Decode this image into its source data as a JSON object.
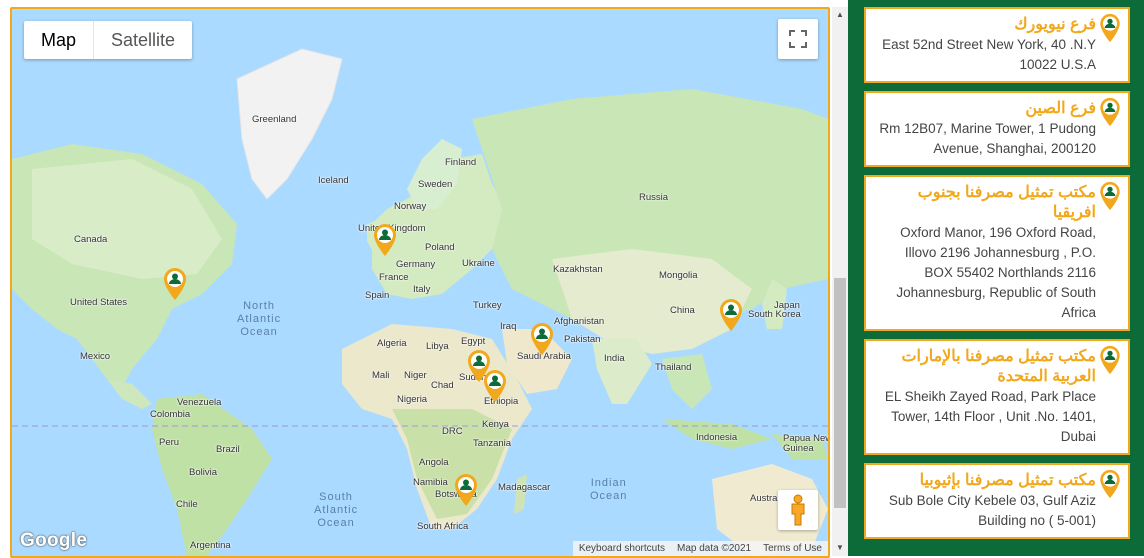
{
  "map": {
    "type_control": {
      "map_label": "Map",
      "satellite_label": "Satellite"
    },
    "logo": "Google",
    "attribution": {
      "shortcuts": "Keyboard shortcuts",
      "data": "Map data ©2021",
      "terms": "Terms of Use"
    },
    "labels": {
      "greenland": "Greenland",
      "iceland": "Iceland",
      "finland": "Finland",
      "sweden": "Sweden",
      "norway": "Norway",
      "russia": "Russia",
      "uk": "United Kingdom",
      "poland": "Poland",
      "germany": "Germany",
      "ukraine": "Ukraine",
      "france": "France",
      "spain": "Spain",
      "italy": "Italy",
      "kazakhstan": "Kazakhstan",
      "mongolia": "Mongolia",
      "turkey": "Turkey",
      "iraq": "Iraq",
      "afghanistan": "Afghanistan",
      "pakistan": "Pakistan",
      "china": "China",
      "japan": "Japan",
      "south_korea": "South Korea",
      "india": "India",
      "thailand": "Thailand",
      "saudi_arabia": "Saudi Arabia",
      "egypt": "Egypt",
      "libya": "Libya",
      "algeria": "Algeria",
      "mali": "Mali",
      "niger": "Niger",
      "chad": "Chad",
      "sudan": "Sudan",
      "nigeria": "Nigeria",
      "ethiopia": "Ethiopia",
      "kenya": "Kenya",
      "drc": "DRC",
      "tanzania": "Tanzania",
      "angola": "Angola",
      "namibia": "Namibia",
      "botswana": "Botswana",
      "madagascar": "Madagascar",
      "south_africa": "South Africa",
      "canada": "Canada",
      "united_states": "United States",
      "mexico": "Mexico",
      "venezuela": "Venezuela",
      "colombia": "Colombia",
      "peru": "Peru",
      "brazil": "Brazil",
      "bolivia": "Bolivia",
      "chile": "Chile",
      "argentina": "Argentina",
      "indonesia": "Indonesia",
      "papua": "Papua New Guinea",
      "australia": "Australia"
    },
    "oceans": {
      "north_atlantic": [
        "North",
        "Atlantic",
        "Ocean"
      ],
      "south_atlantic": [
        "South",
        "Atlantic",
        "Ocean"
      ],
      "indian": [
        "Indian",
        "Ocean"
      ]
    }
  },
  "branches": [
    {
      "title": "فرع نيويورك",
      "address": "East 52nd Street New York, 40 .N.Y 10022 U.S.A"
    },
    {
      "title": "فرع الصين",
      "address": "Rm 12B07, Marine Tower, 1 Pudong Avenue, Shanghai, 200120"
    },
    {
      "title": "مكتب تمثيل مصرفنا بجنوب افريقيا",
      "address": "Oxford Manor, 196 Oxford Road, Illovo 2196 Johannesburg , P.O. BOX 55402 Northlands 2116 Johannesburg, Republic of South Africa"
    },
    {
      "title": "مكتب تمثيل مصرفنا بالإمارات العربية المتحدة",
      "address": "EL Sheikh Zayed Road, Park Place Tower, 14th Floor , Unit .No. 1401, Dubai"
    },
    {
      "title": "مكتب تمثيل مصرفنا بإثيوبيا",
      "address": "Sub Bole City Kebele 03, Gulf Aziz Building no ( 5-001)"
    }
  ],
  "colors": {
    "accent": "#f2a81d",
    "panel_green": "#0d6b3a",
    "marker_icon": "#0d6b3a"
  }
}
